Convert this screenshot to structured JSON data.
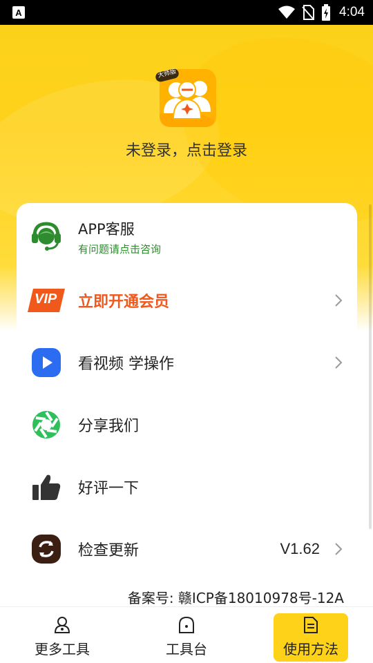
{
  "status_bar": {
    "time": "4:04",
    "notification_icon": "A"
  },
  "header": {
    "logo_badge": "大师版",
    "login_prompt": "未登录，点击登录"
  },
  "menu": {
    "service": {
      "title": "APP客服",
      "subtitle": "有问题请点击咨询",
      "icon": "headset-icon"
    },
    "vip": {
      "badge": "VIP",
      "label": "立即开通会员"
    },
    "video": {
      "label": "看视频 学操作",
      "icon": "play-icon"
    },
    "share": {
      "label": "分享我们",
      "icon": "shutter-icon"
    },
    "rate": {
      "label": "好评一下",
      "icon": "thumbs-up-icon"
    },
    "update": {
      "label": "检查更新",
      "value": "V1.62",
      "icon": "refresh-icon"
    }
  },
  "icp": "备案号: 赣ICP备18010978号-12A",
  "bottom_nav": {
    "items": [
      {
        "label": "更多工具",
        "icon": "person-icon"
      },
      {
        "label": "工具台",
        "icon": "home-dot-icon"
      },
      {
        "label": "使用方法",
        "icon": "document-icon"
      }
    ],
    "active_index": 2
  },
  "colors": {
    "brand_yellow": "#ffd21a",
    "vip_orange": "#f0581c",
    "service_green": "#2e8b2e",
    "video_blue": "#2b6cf0",
    "share_green": "#2ec05a"
  }
}
